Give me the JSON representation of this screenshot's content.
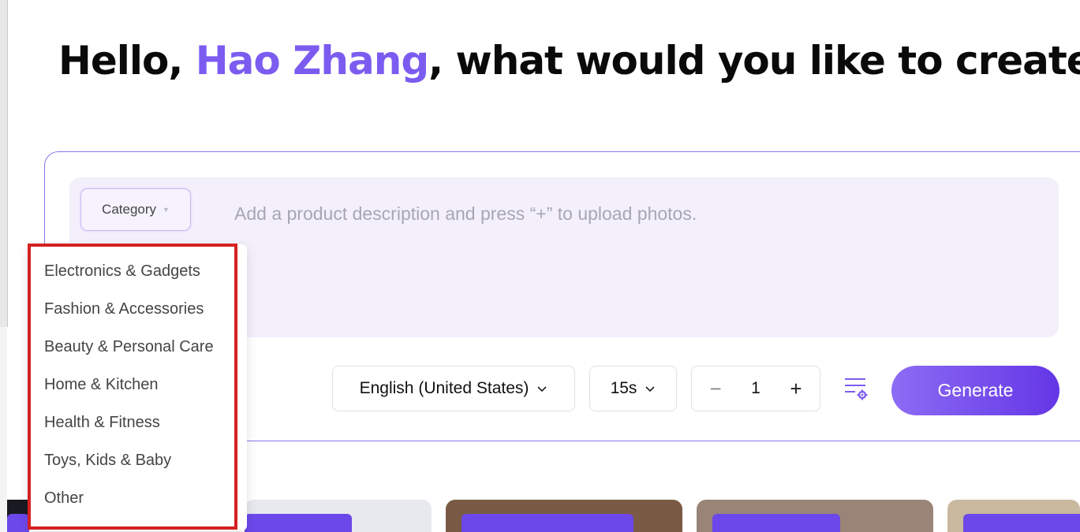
{
  "header": {
    "greeting_prefix": "Hello, ",
    "user_name": "Hao Zhang",
    "greeting_suffix": ", what would you like to create?"
  },
  "composer": {
    "category_label": "Category",
    "placeholder": "Add a product description and press “+” to upload photos.",
    "language": "English (United States)",
    "duration": "15s",
    "quantity": "1",
    "minus_symbol": "−",
    "plus_symbol": "+",
    "generate_label": "Generate"
  },
  "category_menu": {
    "items": [
      "Electronics & Gadgets",
      "Fashion & Accessories",
      "Beauty & Personal Care",
      "Home & Kitchen",
      "Health & Fitness",
      "Toys, Kids & Baby",
      "Other"
    ]
  },
  "colors": {
    "accent": "#7c5cf0",
    "generate_gradient_start": "#8d6cf4",
    "generate_gradient_end": "#6436e6",
    "highlight": "#d42020"
  }
}
